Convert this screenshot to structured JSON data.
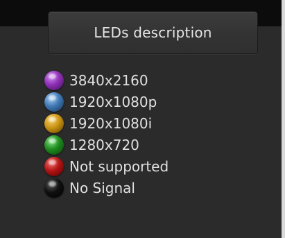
{
  "header": {
    "title": "LEDs description"
  },
  "legend": {
    "items": [
      {
        "label": "3840x2160",
        "icon": "purple-led-icon",
        "color": "#8e2fb5",
        "highlight": "#d08cf0",
        "shade": "#3d0f55"
      },
      {
        "label": "1920x1080p",
        "icon": "blue-led-icon",
        "color": "#3f78b4",
        "highlight": "#a9d0f5",
        "shade": "#16324f"
      },
      {
        "label": "1920x1080i",
        "icon": "yellow-led-icon",
        "color": "#c99312",
        "highlight": "#f6d26c",
        "shade": "#5a3e00"
      },
      {
        "label": "1280x720",
        "icon": "green-led-icon",
        "color": "#1e8a1e",
        "highlight": "#7fe07f",
        "shade": "#0a3c0a"
      },
      {
        "label": "Not supported",
        "icon": "red-led-icon",
        "color": "#b31414",
        "highlight": "#f07070",
        "shade": "#4b0000"
      },
      {
        "label": "No Signal",
        "icon": "black-led-icon",
        "color": "#101010",
        "highlight": "#5a5a5a",
        "shade": "#000000"
      }
    ]
  }
}
